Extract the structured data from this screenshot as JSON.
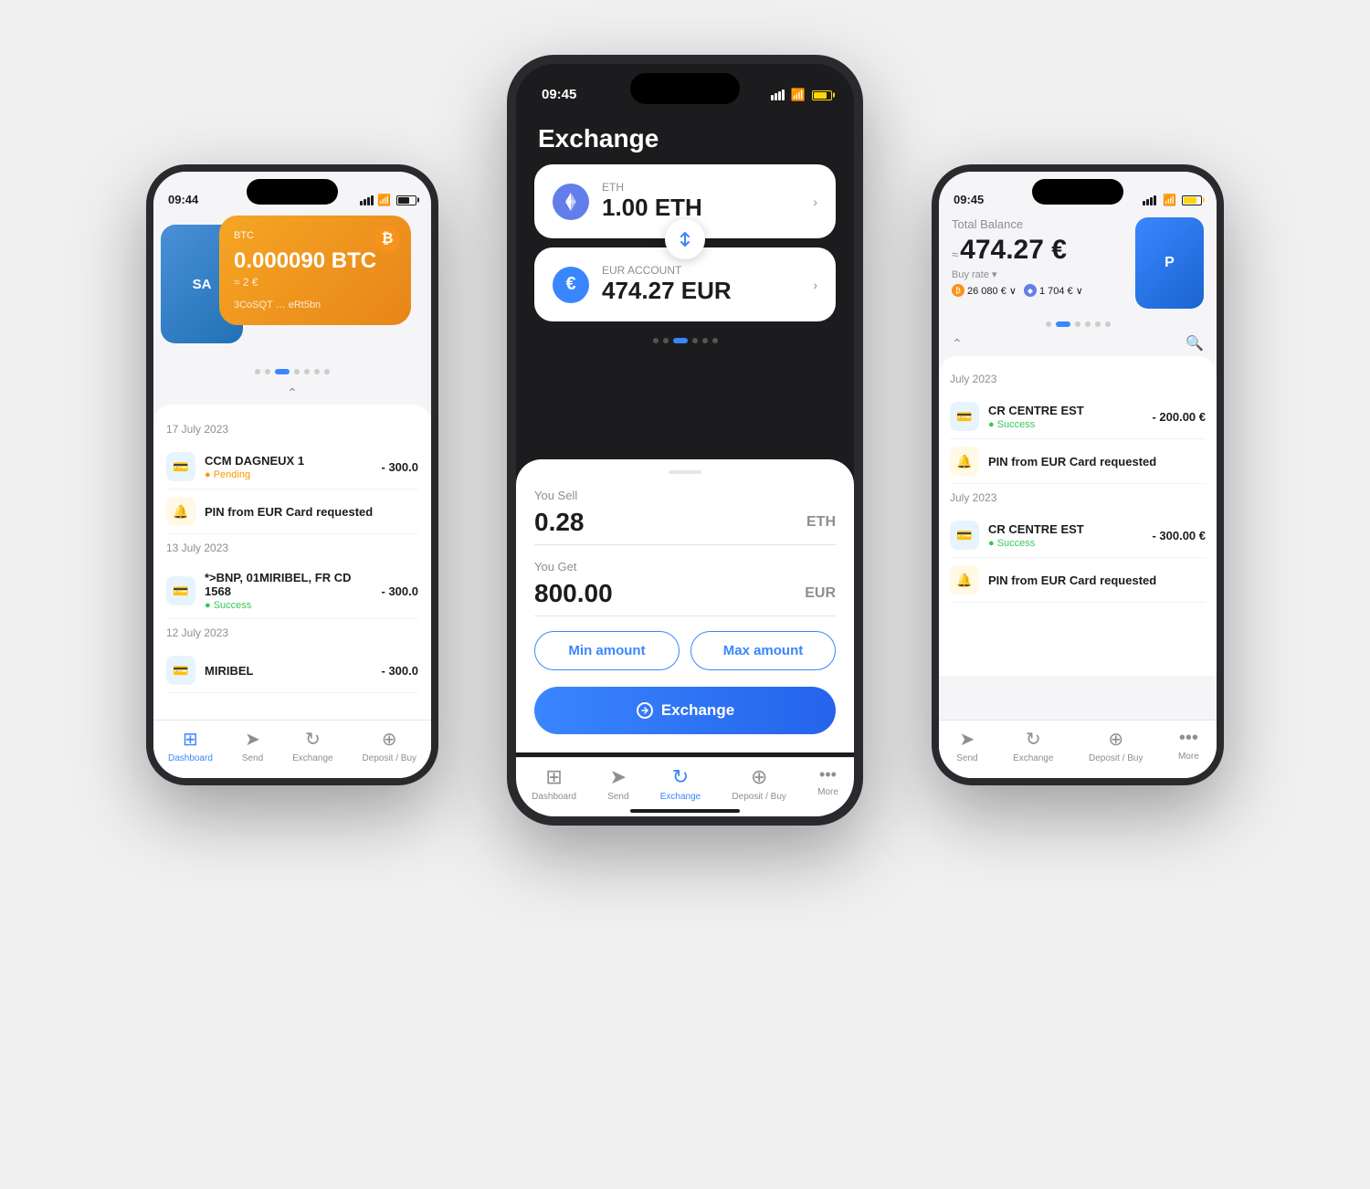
{
  "scene": {
    "background": "#e8e8ed"
  },
  "left_phone": {
    "status_time": "09:44",
    "card": {
      "label": "BTC",
      "amount": "0.000090 BTC",
      "eur_approx": "≈ 2 €",
      "address": "3CoSQT … eRt5bn",
      "btc_symbol": "₿"
    },
    "dots": [
      false,
      false,
      true,
      false,
      false,
      false,
      false
    ],
    "transactions": {
      "date1": "17 July 2023",
      "items": [
        {
          "name": "CCM DAGNEUX 1",
          "amount": "- 300.0",
          "status": "Pending",
          "status_type": "pending"
        },
        {
          "name": "PIN from EUR Card requested",
          "amount": "",
          "status": "",
          "status_type": ""
        },
        {
          "name": "*>BNP, 01MIRIBEL, FR CD 1568",
          "amount": "- 300.0",
          "status": "Success",
          "status_type": "success"
        }
      ],
      "date2": "13 July 2023",
      "items2": [
        {
          "name": "*>BNP, 01MIRIBEL, FR CD 1568",
          "amount": "- 300.0",
          "status": "Success",
          "status_type": "success"
        }
      ],
      "date3": "12 July 2023",
      "items3": [
        {
          "name": "MIRIBEL",
          "amount": "- 300.0",
          "status": "",
          "status_type": ""
        }
      ]
    },
    "nav": {
      "items": [
        {
          "label": "Dashboard",
          "icon": "🏠",
          "active": true
        },
        {
          "label": "Send",
          "icon": "➤",
          "active": false
        },
        {
          "label": "Exchange",
          "icon": "↻",
          "active": false
        },
        {
          "label": "Deposit / Buy",
          "icon": "✚",
          "active": false
        }
      ]
    }
  },
  "center_phone": {
    "status_time": "09:45",
    "title": "Exchange",
    "from_coin": {
      "label": "ETH",
      "amount": "1.00 ETH"
    },
    "to_coin": {
      "label": "EUR ACCOUNT",
      "amount": "474.27 EUR"
    },
    "sell_label": "You Sell",
    "sell_value": "0.28",
    "sell_currency": "ETH",
    "get_label": "You Get",
    "get_value": "800.00",
    "get_currency": "EUR",
    "min_amount_btn": "Min amount",
    "max_amount_btn": "Max amount",
    "exchange_btn": "Exchange",
    "nav": {
      "items": [
        {
          "label": "Dashboard",
          "icon": "🏠",
          "active": false
        },
        {
          "label": "Send",
          "icon": "➤",
          "active": false
        },
        {
          "label": "Exchange",
          "icon": "↻",
          "active": true
        },
        {
          "label": "Deposit / Buy",
          "icon": "✚",
          "active": false
        },
        {
          "label": "More",
          "icon": "•••",
          "active": false
        }
      ]
    }
  },
  "right_phone": {
    "status_time": "09:45",
    "total_balance_label": "Total Balance",
    "total_balance_amount": "474.27 €",
    "buy_rate": "Buy rate ▾",
    "btc_rate": "26 080 € ∨",
    "eth_rate": "1 704 € ∨",
    "dots": [
      false,
      false,
      true,
      false,
      false,
      false,
      false
    ],
    "search_icon": "🔍",
    "transactions": {
      "date1": "July 2023",
      "items": [
        {
          "name": "CR CENTRE EST",
          "amount": "- 200.00 €",
          "status": "Success",
          "status_type": "success"
        },
        {
          "name": "PIN from EUR Card requested",
          "amount": "",
          "status": "",
          "status_type": ""
        }
      ],
      "date2": "July 2023",
      "items2": [
        {
          "name": "CR CENTRE EST",
          "amount": "- 300.00 €",
          "status": "Success",
          "status_type": "success"
        },
        {
          "name": "PIN from EUR Card requested",
          "amount": "",
          "status": "",
          "status_type": ""
        }
      ]
    },
    "nav": {
      "items": [
        {
          "label": "Send",
          "icon": "➤",
          "active": false
        },
        {
          "label": "Exchange",
          "icon": "↻",
          "active": false
        },
        {
          "label": "Deposit / Buy",
          "icon": "✚",
          "active": false
        },
        {
          "label": "More",
          "icon": "•••",
          "active": false
        }
      ]
    }
  }
}
